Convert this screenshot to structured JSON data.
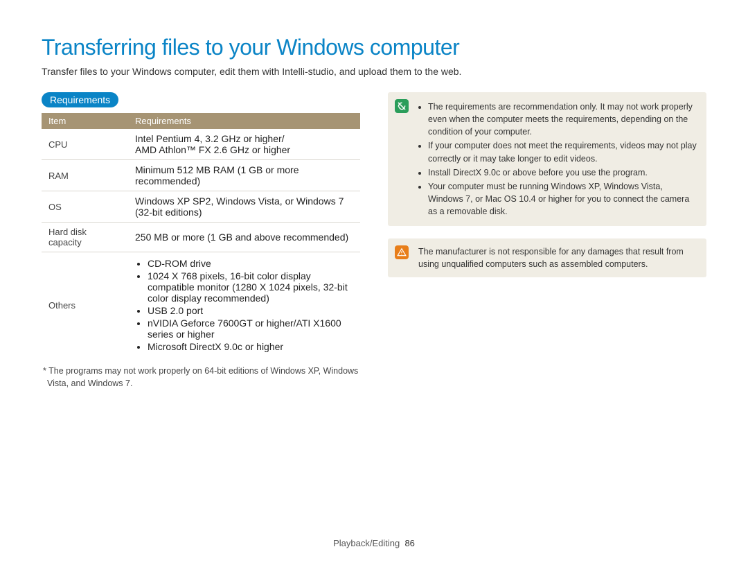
{
  "title": "Transferring files to your Windows computer",
  "intro": "Transfer files to your Windows computer, edit them with Intelli-studio, and upload them to the web.",
  "section_label": "Requirements",
  "table": {
    "headers": [
      "Item",
      "Requirements"
    ],
    "rows": [
      {
        "item": "CPU",
        "value_lines": [
          "Intel Pentium 4, 3.2 GHz or higher/",
          "AMD Athlon™ FX 2.6 GHz or higher"
        ]
      },
      {
        "item": "RAM",
        "value_lines": [
          "Minimum 512 MB RAM (1 GB or more recommended)"
        ]
      },
      {
        "item": "OS",
        "value_lines": [
          "Windows XP SP2, Windows Vista, or Windows 7",
          "(32-bit editions)"
        ]
      },
      {
        "item": "Hard disk capacity",
        "value_lines": [
          "250 MB or more (1 GB and above recommended)"
        ]
      },
      {
        "item": "Others",
        "value_list": [
          "CD-ROM drive",
          "1024 X 768 pixels, 16-bit color display compatible monitor (1280 X 1024 pixels, 32-bit color display recommended)",
          "USB 2.0 port",
          "nVIDIA Geforce 7600GT or higher/ATI X1600 series or higher",
          "Microsoft DirectX 9.0c or higher"
        ]
      }
    ]
  },
  "footnote": "* The programs may not work properly on 64-bit editions of Windows XP, Windows Vista, and Windows 7.",
  "info_notes": [
    "The requirements are recommendation only. It may not work properly even when the computer meets the requirements, depending on the condition of your computer.",
    "If your computer does not meet the requirements, videos may not play correctly or it may take longer to edit videos.",
    "Install DirectX 9.0c or above before you use the program.",
    "Your computer must be running Windows XP, Windows Vista, Windows 7, or Mac OS 10.4 or higher for you to connect the camera as a removable disk."
  ],
  "warn_note": "The manufacturer is not responsible for any damages that result from using unqualified computers such as assembled computers.",
  "footer": {
    "section": "Playback/Editing",
    "page": "86"
  }
}
